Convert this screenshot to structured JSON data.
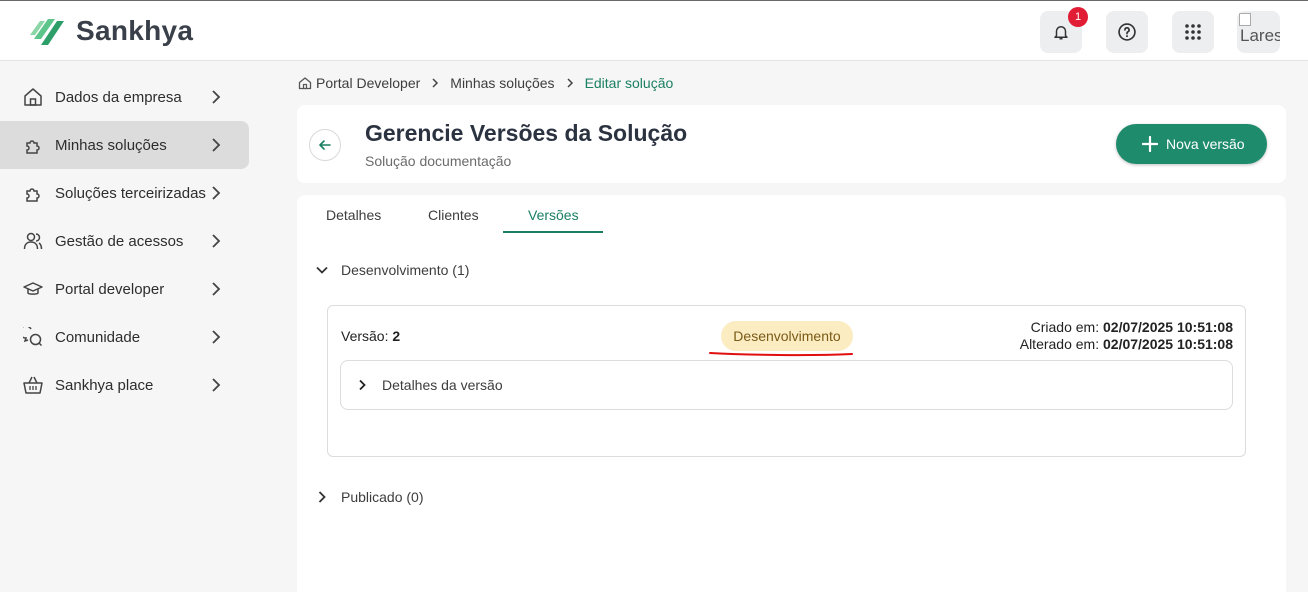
{
  "brand": {
    "name": "Sankhya",
    "color": "#1f8b6d"
  },
  "header": {
    "notifications_count": "1",
    "notifications_icon": "bell-icon",
    "help_icon": "help-circle-icon",
    "apps_icon": "apps-grid-icon",
    "avatar_alt": "Lares"
  },
  "sidebar": {
    "items": [
      {
        "label": "Dados da empresa",
        "icon": "building-icon"
      },
      {
        "label": "Minhas soluções",
        "icon": "puzzle-icon",
        "active": true
      },
      {
        "label": "Soluções terceirizadas",
        "icon": "puzzle-outline-icon"
      },
      {
        "label": "Gestão de acessos",
        "icon": "users-icon"
      },
      {
        "label": "Portal developer",
        "icon": "graduation-cap-icon"
      },
      {
        "label": "Comunidade",
        "icon": "chat-bubbles-icon"
      },
      {
        "label": "Sankhya place",
        "icon": "basket-icon"
      }
    ]
  },
  "breadcrumb": {
    "items": [
      "Portal Developer",
      "Minhas soluções",
      "Editar solução"
    ]
  },
  "page": {
    "title": "Gerencie Versões da Solução",
    "subtitle": "Solução documentação",
    "new_button": "Nova versão"
  },
  "tabs": {
    "items": [
      "Detalhes",
      "Clientes",
      "Versões"
    ],
    "active": "Versões"
  },
  "sections": {
    "development": {
      "label": "Desenvolvimento (1)",
      "version_label": "Versão:",
      "version_number": "2",
      "status": "Desenvolvimento",
      "created_label": "Criado em:",
      "created_value": "02/07/2025 10:51:08",
      "updated_label": "Alterado em:",
      "updated_value": "02/07/2025 10:51:08",
      "details_label": "Detalhes da versão"
    },
    "published": {
      "label": "Publicado (0)"
    }
  },
  "colors": {
    "accent": "#1a7f62",
    "status_bg": "#fbecc2",
    "badge": "#e11d35",
    "annotation": "#e01010"
  }
}
